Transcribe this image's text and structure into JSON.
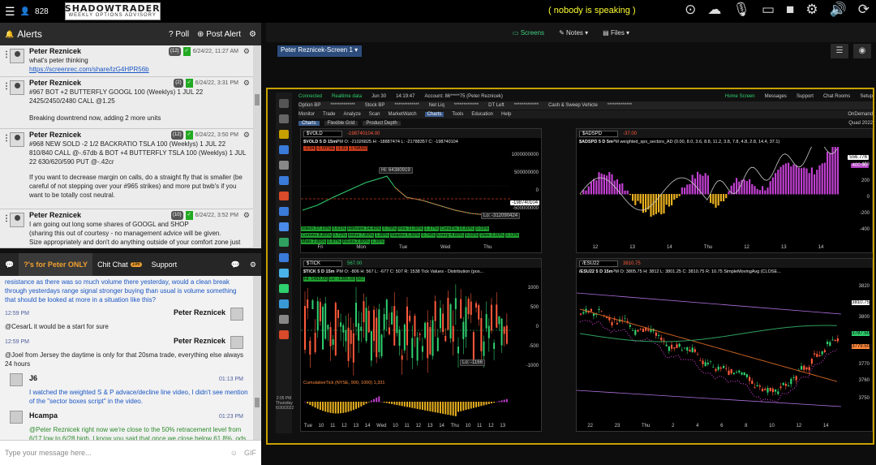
{
  "topbar": {
    "viewer_count": "828",
    "logo_line1": "SHADOWTRADER",
    "logo_line2": "WEEKLY OPTIONS ADVISORY",
    "speaking": "( nobody is speaking )"
  },
  "alerts": {
    "title": "Alerts",
    "poll_label": "Poll",
    "post_label": "Post Alert",
    "items": [
      {
        "name": "Peter Reznicek",
        "count": "(12)",
        "time": "6/24/22, 11:27 AM",
        "text": "what's peter thinking",
        "link": "https://screenrec.com/share/lzG4HPR56b"
      },
      {
        "name": "Peter Reznicek",
        "count": "(2)",
        "time": "6/24/22, 3:31 PM",
        "text": "#967 BOT +2 BUTTERFLY GOOGL 100 (Weeklys) 1 JUL 22 2425/2450/2480 CALL @1.25",
        "text2": "Breaking downtrend now, adding 2 more units"
      },
      {
        "name": "Peter Reznicek",
        "count": "(12)",
        "time": "6/24/22, 3:50 PM",
        "text": "#968 NEW SOLD -2 1/2 BACKRATIO TSLA 100 (Weeklys) 1 JUL 22 810/840 CALL @-.67db & BOT +4 BUTTERFLY TSLA 100 (Weeklys) 1 JUL 22 630/620/590 PUT @-.42cr",
        "text2": "If you want to decrease margin on calls, do a straight fly that is smaller (be careful of not stepping over your #965 strikes) and more put bwb's if you want to be totally cost neutral."
      },
      {
        "name": "Peter Reznicek",
        "count": "(10)",
        "time": "6/24/22, 3:52 PM",
        "text": "I am going out long some shares of GOOGL and SHOP",
        "text2": "(sharing this out of courtesy - no management advice will be given.",
        "text3": "Size appropriately and don't do anything outside of your comfort zone just"
      }
    ]
  },
  "chat": {
    "tab_peter": "?'s for Peter ONLY",
    "tab_chitchat": "Chit Chat",
    "tab_chitchat_badge": "196",
    "tab_support": "Support",
    "top_text": "resistance as there was so much volume there yesterday, would a clean break through yesterdays range signal stronger buying than usual is volume something that should be looked at more in a situation like this?",
    "messages": [
      {
        "time": "12:59 PM",
        "name": "Peter Reznicek",
        "text": "@CesarL it would be a start for sure",
        "color": "dark"
      },
      {
        "time": "12:59 PM",
        "name": "Peter Reznicek",
        "text": "@Joel from Jersey the daytime is only for that 20sma trade, everything else always 24 hours",
        "color": "dark"
      },
      {
        "time": "01:13 PM",
        "name": "J6",
        "text": "I watched the weighted S & P advace/decline line video, I didn't see mention of the \"sector boxes script\" in the video.",
        "color": "blue"
      },
      {
        "time": "01:23 PM",
        "name": "Hcampa",
        "text": "@Peter Reznicek right now we're close to the 50% retracement level from 6/17 low to 6/28 high. I know you said that once we close below 61.8%, ods increase that we go to 100% retracement. Would you recommend that we SOH right now until we either close below 61.8% or break downtrend?",
        "color": "green"
      }
    ],
    "input_placeholder": "Type your message here...",
    "gif_label": "GIF"
  },
  "app": {
    "screens_label": "Screens",
    "notes_label": "Notes",
    "files_label": "Files",
    "screen_tab": "Peter Reznicek-Screen 1"
  },
  "tos": {
    "row1": [
      "Connected",
      "Realtime data",
      "Jun 30",
      "14:19:47",
      "Account: 86*****75 (Peter Reznicek)",
      "Home Screen",
      "Messages",
      "Support",
      "Chat Rooms",
      "Setup"
    ],
    "row2": [
      "Option BP",
      "*************",
      "Stock BP",
      "*************",
      "Net Liq",
      "*************",
      "DT Left",
      "*************",
      "Cash & Sweep Vehicle",
      "*************"
    ],
    "row3": [
      "Monitor",
      "Trade",
      "Analyze",
      "Scan",
      "MarketWatch",
      "Charts",
      "Tools",
      "Education",
      "Help"
    ],
    "row4": [
      "Charts",
      "Flexible Grid",
      "Product Depth"
    ],
    "ondemand": "OnDemand",
    "quad": "Quad 2022",
    "date_box": [
      "2:05 PM",
      "Thursday",
      "6/30/2022"
    ]
  },
  "charts": [
    {
      "id": "vold",
      "symbol": "$VOLD",
      "value": "-198740104.00",
      "title": "$VOLD 5 D 15m",
      "ohlc": "D: 6/30/22, 2:15 PM   O: -21026825   H: -18887474   L: -21788357   C: -198740104",
      "hi_label": "Hi: 64380919",
      "lo_label": "Lo: -312090424",
      "last": "-198740104",
      "ticks": [
        "1000000000",
        "500000000",
        "0",
        "-500000000"
      ],
      "xlabels": [
        "Fri",
        "Mon",
        "Tue",
        "Wed",
        "Thu"
      ],
      "breadth_top": [
        "-2.94",
        "-1 NYSE",
        "-1.61",
        "-1 NASD"
      ],
      "sectors_row1": [
        "Intech 37.10%",
        "0.61%",
        "Hithcare 14.40%",
        "0.79%",
        "Fins 11.00%",
        "1.17%",
        "ConsDis 10.80%",
        "0.09%"
      ],
      "sectors_row2": [
        "Comms 8.80%",
        "0.72%",
        "Indus 7.80%",
        "1.88%",
        "Staples 6.50%",
        "0.74%",
        "Energ 4.80%",
        "0.03%",
        "Utes 3.00%",
        "2.13%"
      ],
      "sectors_row3": [
        "Mats 2.80%",
        "0.87%",
        "REsta 2.80%",
        "1.39%"
      ]
    },
    {
      "id": "adspd",
      "symbol": "$ADSPD",
      "value": "-37.00",
      "title": "$ADSPD 5 D 5m",
      "ohlc": "D: 6/30/22, 2:15 PM   weighted_spx_sectors_AD (0.00, 8.0, 3.6, 8.8, 11.2, 3.8, 7.8, 4.8, 2.8, 14.4, 37.1)",
      "ticks": [
        "400",
        "200",
        "0",
        "-200",
        "-400"
      ],
      "last_tag": "556.776",
      "last_tag2": "400.00",
      "xlabels": [
        "12",
        "13",
        "14",
        "Thu",
        "12",
        "13",
        "14"
      ]
    },
    {
      "id": "tick",
      "symbol": "$TICK",
      "value": "567.00",
      "title": "$TICK 5 D 15m",
      "ohlc": "D: 6/30/22, 2:15 PM   O: -806   H: 567   L: -677   C: 507   R: 1538   Tick Values - Distribution (pos...",
      "hi_label": "Hi: 1493.00",
      "lo_label": "Lo: -1386.00",
      "last": "567",
      "lo2": "Lo: -1166",
      "ticks": [
        "1000",
        "500",
        "0",
        "-500",
        "-1000"
      ],
      "cum_label": "CumulativeTick (NYSE, 900, 1000)  1,331",
      "xlabels": [
        "Tue",
        "10",
        "11",
        "12",
        "13",
        "14",
        "Wed",
        "10",
        "11",
        "12",
        "13",
        "14",
        "Thu",
        "10",
        "11",
        "12",
        "13"
      ]
    },
    {
      "id": "esu22",
      "symbol": "/ESU22",
      "value": "3810.75",
      "title": "/ESU22 5 D 15m",
      "ohlc": "D: 6/30/22, 2:15 PM   O: 3805.75   H: 3812   L: 3801.25   C: 3810.75   R: 10.75   SimpleMovingAvg (CLOSE...",
      "ticks": [
        "3820",
        "3810.75",
        "3800",
        "3787.50",
        "3779.50",
        "3770",
        "3760",
        "3750"
      ],
      "xlabels": [
        "22",
        "23",
        "Thu",
        "2",
        "4",
        "6",
        "8",
        "10",
        "12",
        "14",
        "22",
        "23",
        "Thu",
        "2",
        "4",
        "6",
        "8",
        "10",
        "12",
        "14"
      ]
    }
  ]
}
